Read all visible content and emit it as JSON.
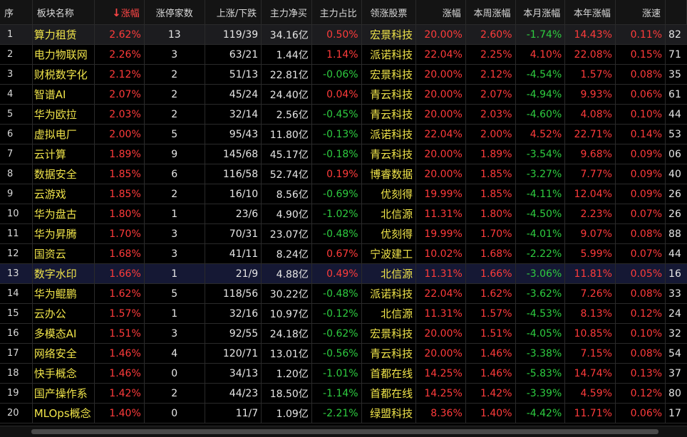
{
  "headers": {
    "idx": "序",
    "name": "板块名称",
    "pct": "涨幅",
    "limit": "涨停家数",
    "updown": "上涨/下跌",
    "net": "主力净买",
    "ratio": "主力占比",
    "lead": "领涨股票",
    "lead_pct": "涨幅",
    "week": "本周涨幅",
    "month": "本月涨幅",
    "year": "本年涨幅",
    "speed": "涨速"
  },
  "colors": {
    "up": "#ff3b3b",
    "down": "#2ecc40",
    "name": "#f0e44a",
    "selected_row": "#151834"
  },
  "rows": [
    {
      "idx": "1",
      "name": "算力租赁",
      "pct": "2.62%",
      "limit": "13",
      "updown": "119/39",
      "net": "34.16亿",
      "ratio": "0.50%",
      "lead": "宏景科技",
      "lead_pct": "20.00%",
      "week": "2.60%",
      "month": "-1.74%",
      "year": "14.43%",
      "speed": "0.11%",
      "extra": "82"
    },
    {
      "idx": "2",
      "name": "电力物联网",
      "pct": "2.26%",
      "limit": "3",
      "updown": "63/21",
      "net": "1.44亿",
      "ratio": "1.14%",
      "lead": "派诺科技",
      "lead_pct": "22.04%",
      "week": "2.25%",
      "month": "4.10%",
      "year": "22.08%",
      "speed": "0.15%",
      "extra": "71"
    },
    {
      "idx": "3",
      "name": "财税数字化",
      "pct": "2.12%",
      "limit": "2",
      "updown": "51/13",
      "net": "22.81亿",
      "ratio": "-0.06%",
      "lead": "宏景科技",
      "lead_pct": "20.00%",
      "week": "2.12%",
      "month": "-4.54%",
      "year": "1.57%",
      "speed": "0.08%",
      "extra": "35"
    },
    {
      "idx": "4",
      "name": "智谱AI",
      "pct": "2.07%",
      "limit": "2",
      "updown": "45/24",
      "net": "24.40亿",
      "ratio": "0.04%",
      "lead": "青云科技",
      "lead_pct": "20.00%",
      "week": "2.07%",
      "month": "-4.94%",
      "year": "9.93%",
      "speed": "0.06%",
      "extra": "61"
    },
    {
      "idx": "5",
      "name": "华为欧拉",
      "pct": "2.03%",
      "limit": "2",
      "updown": "32/14",
      "net": "2.56亿",
      "ratio": "-0.45%",
      "lead": "青云科技",
      "lead_pct": "20.00%",
      "week": "2.03%",
      "month": "-4.60%",
      "year": "4.08%",
      "speed": "0.10%",
      "extra": "44"
    },
    {
      "idx": "6",
      "name": "虚拟电厂",
      "pct": "2.00%",
      "limit": "5",
      "updown": "95/43",
      "net": "11.80亿",
      "ratio": "-0.13%",
      "lead": "派诺科技",
      "lead_pct": "22.04%",
      "week": "2.00%",
      "month": "4.52%",
      "year": "22.71%",
      "speed": "0.14%",
      "extra": "53"
    },
    {
      "idx": "7",
      "name": "云计算",
      "pct": "1.89%",
      "limit": "9",
      "updown": "145/68",
      "net": "45.17亿",
      "ratio": "-0.18%",
      "lead": "青云科技",
      "lead_pct": "20.00%",
      "week": "1.89%",
      "month": "-3.54%",
      "year": "9.68%",
      "speed": "0.09%",
      "extra": "06"
    },
    {
      "idx": "8",
      "name": "数据安全",
      "pct": "1.85%",
      "limit": "6",
      "updown": "116/58",
      "net": "52.74亿",
      "ratio": "0.19%",
      "lead": "博睿数据",
      "lead_pct": "20.00%",
      "week": "1.85%",
      "month": "-3.27%",
      "year": "7.77%",
      "speed": "0.09%",
      "extra": "40"
    },
    {
      "idx": "9",
      "name": "云游戏",
      "pct": "1.85%",
      "limit": "2",
      "updown": "16/10",
      "net": "8.56亿",
      "ratio": "-0.69%",
      "lead": "优刻得",
      "lead_pct": "19.99%",
      "week": "1.85%",
      "month": "-4.11%",
      "year": "12.04%",
      "speed": "0.09%",
      "extra": "26"
    },
    {
      "idx": "10",
      "name": "华为盘古",
      "pct": "1.80%",
      "limit": "1",
      "updown": "23/6",
      "net": "4.90亿",
      "ratio": "-1.02%",
      "lead": "北信源",
      "lead_pct": "11.31%",
      "week": "1.80%",
      "month": "-4.50%",
      "year": "2.23%",
      "speed": "0.07%",
      "extra": "26"
    },
    {
      "idx": "11",
      "name": "华为昇腾",
      "pct": "1.70%",
      "limit": "3",
      "updown": "70/31",
      "net": "23.07亿",
      "ratio": "-0.48%",
      "lead": "优刻得",
      "lead_pct": "19.99%",
      "week": "1.70%",
      "month": "-4.01%",
      "year": "9.07%",
      "speed": "0.08%",
      "extra": "88"
    },
    {
      "idx": "12",
      "name": "国资云",
      "pct": "1.68%",
      "limit": "3",
      "updown": "41/11",
      "net": "8.24亿",
      "ratio": "0.67%",
      "lead": "宁波建工",
      "lead_pct": "10.02%",
      "week": "1.68%",
      "month": "-2.22%",
      "year": "5.99%",
      "speed": "0.07%",
      "extra": "44"
    },
    {
      "idx": "13",
      "name": "数字水印",
      "pct": "1.66%",
      "limit": "1",
      "updown": "21/9",
      "net": "4.88亿",
      "ratio": "0.49%",
      "lead": "北信源",
      "lead_pct": "11.31%",
      "week": "1.66%",
      "month": "-3.06%",
      "year": "11.81%",
      "speed": "0.05%",
      "extra": "16"
    },
    {
      "idx": "14",
      "name": "华为鲲鹏",
      "pct": "1.62%",
      "limit": "5",
      "updown": "118/56",
      "net": "30.22亿",
      "ratio": "-0.48%",
      "lead": "派诺科技",
      "lead_pct": "22.04%",
      "week": "1.62%",
      "month": "-3.62%",
      "year": "7.26%",
      "speed": "0.08%",
      "extra": "33"
    },
    {
      "idx": "15",
      "name": "云办公",
      "pct": "1.57%",
      "limit": "1",
      "updown": "32/16",
      "net": "10.97亿",
      "ratio": "-0.12%",
      "lead": "北信源",
      "lead_pct": "11.31%",
      "week": "1.57%",
      "month": "-4.53%",
      "year": "8.13%",
      "speed": "0.12%",
      "extra": "24"
    },
    {
      "idx": "16",
      "name": "多模态AI",
      "pct": "1.51%",
      "limit": "3",
      "updown": "92/55",
      "net": "24.18亿",
      "ratio": "-0.62%",
      "lead": "宏景科技",
      "lead_pct": "20.00%",
      "week": "1.51%",
      "month": "-4.05%",
      "year": "10.85%",
      "speed": "0.10%",
      "extra": "32"
    },
    {
      "idx": "17",
      "name": "网络安全",
      "pct": "1.46%",
      "limit": "4",
      "updown": "120/71",
      "net": "13.01亿",
      "ratio": "-0.56%",
      "lead": "青云科技",
      "lead_pct": "20.00%",
      "week": "1.46%",
      "month": "-3.38%",
      "year": "7.15%",
      "speed": "0.08%",
      "extra": "54"
    },
    {
      "idx": "18",
      "name": "快手概念",
      "pct": "1.46%",
      "limit": "0",
      "updown": "34/13",
      "net": "1.20亿",
      "ratio": "-1.01%",
      "lead": "首都在线",
      "lead_pct": "14.25%",
      "week": "1.46%",
      "month": "-5.83%",
      "year": "14.74%",
      "speed": "0.13%",
      "extra": "37"
    },
    {
      "idx": "19",
      "name": "国产操作系",
      "pct": "1.42%",
      "limit": "2",
      "updown": "44/23",
      "net": "18.50亿",
      "ratio": "-1.14%",
      "lead": "首都在线",
      "lead_pct": "14.25%",
      "week": "1.42%",
      "month": "-3.39%",
      "year": "4.59%",
      "speed": "0.12%",
      "extra": "80"
    },
    {
      "idx": "20",
      "name": "MLOps概念",
      "pct": "1.40%",
      "limit": "0",
      "updown": "11/7",
      "net": "1.09亿",
      "ratio": "-2.21%",
      "lead": "绿盟科技",
      "lead_pct": "8.36%",
      "week": "1.40%",
      "month": "-4.42%",
      "year": "11.71%",
      "speed": "0.06%",
      "extra": "17"
    }
  ]
}
